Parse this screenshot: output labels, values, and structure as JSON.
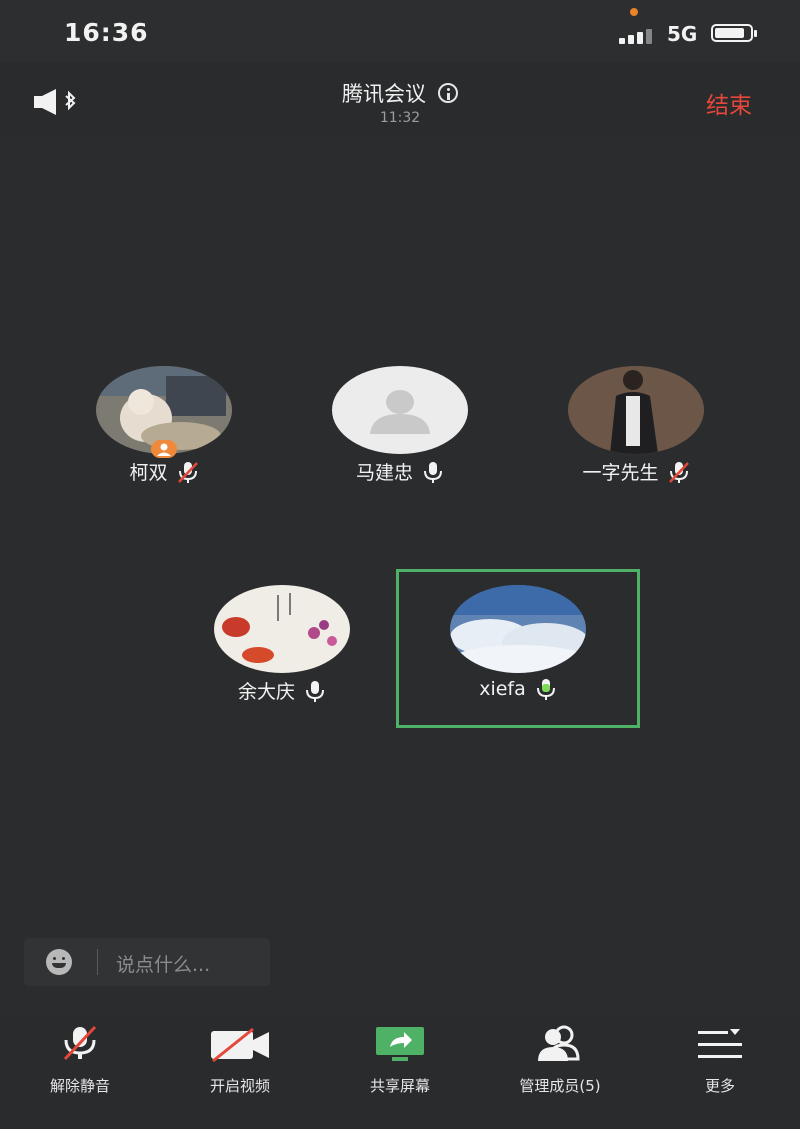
{
  "status_bar": {
    "time": "16:36",
    "network": "5G",
    "battery_level": 0.85
  },
  "header": {
    "title": "腾讯会议",
    "duration": "11:32",
    "end_label": "结束"
  },
  "participants": [
    {
      "name": "柯双",
      "mic": "muted",
      "host": true
    },
    {
      "name": "马建忠",
      "mic": "on",
      "host": false
    },
    {
      "name": "一字先生",
      "mic": "muted",
      "host": false
    },
    {
      "name": "余大庆",
      "mic": "on",
      "host": false
    },
    {
      "name": "xiefa",
      "mic": "speaking",
      "host": false,
      "active": true
    }
  ],
  "chat": {
    "placeholder": "说点什么..."
  },
  "toolbar": {
    "unmute_label": "解除静音",
    "video_label": "开启视频",
    "share_label": "共享屏幕",
    "members_label": "管理成员(5)",
    "more_label": "更多"
  },
  "colors": {
    "end": "#e4483b",
    "share": "#4fb166",
    "speaking": "#7ed957",
    "host_badge": "#ef8a3c"
  }
}
